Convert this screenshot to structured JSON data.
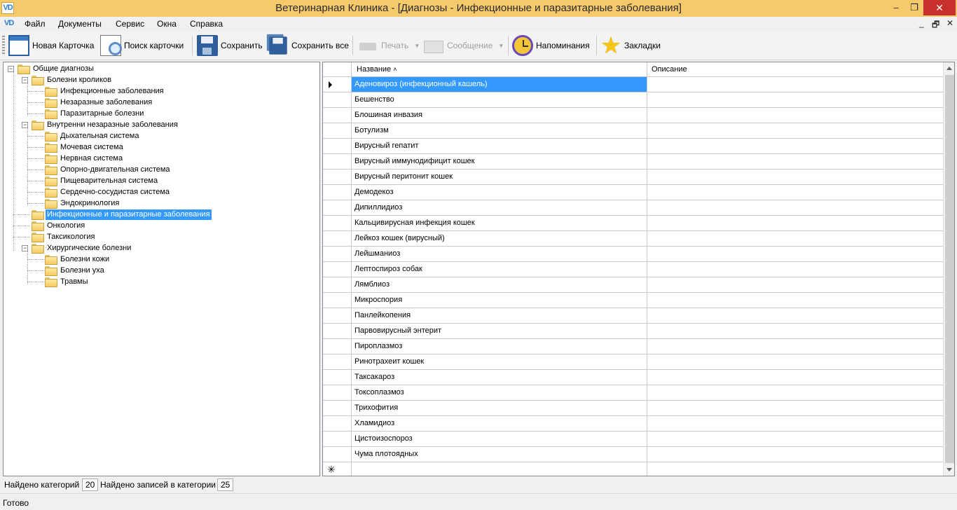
{
  "window": {
    "app_icon_text": "VD",
    "title": "Ветеринарная Клиника - [Диагнозы - Инфекционные и паразитарные заболевания]",
    "minimize": "–",
    "maximize": "❐",
    "close": "✕"
  },
  "menu": {
    "mdi_icon_text": "VD",
    "items": [
      "Файл",
      "Документы",
      "Сервис",
      "Окна",
      "Справка"
    ],
    "mdi_minimize": "_",
    "mdi_restore": "🗗",
    "mdi_close": "✕"
  },
  "toolbar": {
    "new_card": "Новая Карточка",
    "search_card": "Поиск карточки",
    "save": "Сохранить",
    "save_all": "Сохранить все",
    "print": "Печать",
    "message": "Сообщение",
    "reminders": "Напоминания",
    "bookmarks": "Закладки",
    "icons": {
      "new_card": "card-icon",
      "search_card": "search-card-icon",
      "save": "floppy-disk-icon",
      "save_all": "floppy-stack-icon",
      "print": "printer-icon",
      "message": "envelope-icon",
      "reminders": "alarm-clock-icon",
      "bookmarks": "star-icon"
    }
  },
  "tree": {
    "nodes": [
      "Общие диагнозы",
      "Болезни кроликов",
      "Инфекционные заболевания",
      "Незаразные заболевания",
      "Паразитарные болезни",
      "Внутренни незаразные заболевания",
      "Дыхательная система",
      "Мочевая система",
      "Нервная система",
      "Опорно-двигательная система",
      "Пищеварительная система",
      "Сердечно-сосудистая система",
      "Эндокринология",
      "Инфекционные и паразитарные заболевания",
      "Онкология",
      "Таксикология",
      "Хирургические болезни",
      "Болезни кожи",
      "Болезни уха",
      "Травмы"
    ],
    "selected_index": 13
  },
  "grid": {
    "columns": [
      "Название",
      "Описание"
    ],
    "sort_marker": "˄",
    "new_row_marker": "✳",
    "rows": [
      "Аденовироз (инфекционный кашель)",
      "Бешенство",
      "Блошиная инвазия",
      "Ботулизм",
      "Вирусный гепатит",
      "Вирусный иммунодифицит кошек",
      "Вирусный перитонит кошек",
      "Демодекоз",
      "Дипиллидиоз",
      "Кальцивирусная инфекция кошек",
      "Лейкоз кошек (вирусный)",
      "Лейшманиоз",
      "Лептоспироз собак",
      "Лямблиоз",
      "Микроспория",
      "Панлейкопения",
      "Парвовирусный энтерит",
      "Пироплазмоз",
      "Ринотрахеит кошек",
      "Таксакароз",
      "Токсоплазмоз",
      "Трихофития",
      "Хламидиоз",
      "Цистоизоспороз",
      "Чума плотоядных"
    ],
    "selected_index": 0
  },
  "counters": {
    "categories_label": "Найдено категорий",
    "categories_value": "20",
    "records_label": "Найдено записей в категории",
    "records_value": "25"
  },
  "status": {
    "text": "Готово"
  },
  "colors": {
    "titlebar": "#f6c96b",
    "selection": "#3399ff",
    "close_button": "#c7302b"
  }
}
